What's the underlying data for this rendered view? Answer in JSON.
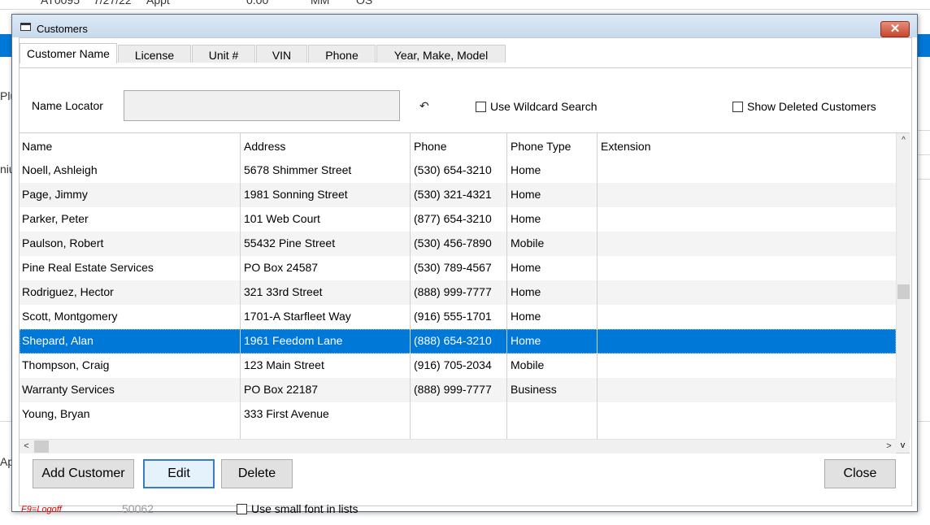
{
  "background": {
    "top_row": [
      "AT0095",
      "7/27/22",
      "Appt",
      "0.00",
      "MM",
      "OS"
    ],
    "left_fragments": [
      "Plu",
      "niu",
      "Ap"
    ]
  },
  "dialog": {
    "title": "Customers",
    "close_glyph": "✕",
    "tabs": [
      "Customer Name",
      "License",
      "Unit #",
      "VIN",
      "Phone",
      "Year, Make, Model"
    ],
    "active_tab": 0,
    "locator": {
      "label": "Name Locator",
      "value": "",
      "undo_glyph": "↶"
    },
    "options": {
      "wildcard": "Use Wildcard Search",
      "show_deleted": "Show Deleted Customers",
      "small_font": "Use small font in lists"
    },
    "grid": {
      "columns": [
        "Name",
        "Address",
        "Phone",
        "Phone Type",
        "Extension"
      ],
      "rows": [
        {
          "name": "Noell, Ashleigh",
          "address": "5678 Shimmer Street",
          "phone": "(530) 654-3210",
          "type": "Home",
          "ext": ""
        },
        {
          "name": "Page, Jimmy",
          "address": "1981 Sonning Street",
          "phone": "(530) 321-4321",
          "type": "Home",
          "ext": ""
        },
        {
          "name": "Parker, Peter",
          "address": "101 Web Court",
          "phone": "(877) 654-3210",
          "type": "Home",
          "ext": ""
        },
        {
          "name": "Paulson, Robert",
          "address": "55432 Pine Street",
          "phone": "(530) 456-7890",
          "type": "Mobile",
          "ext": ""
        },
        {
          "name": "Pine Real Estate Services",
          "address": "PO Box 24587",
          "phone": "(530) 789-4567",
          "type": "Home",
          "ext": ""
        },
        {
          "name": "Rodriguez, Hector",
          "address": "321 33rd Street",
          "phone": "(888) 999-7777",
          "type": "Home",
          "ext": ""
        },
        {
          "name": "Scott, Montgomery",
          "address": "1701-A Starfleet Way",
          "phone": "(916) 555-1701",
          "type": "Home",
          "ext": ""
        },
        {
          "name": "Shepard, Alan",
          "address": "1961 Feedom Lane",
          "phone": "(888) 654-3210",
          "type": "Home",
          "ext": ""
        },
        {
          "name": "Thompson, Craig",
          "address": "123 Main Street",
          "phone": "(916) 705-2034",
          "type": "Mobile",
          "ext": ""
        },
        {
          "name": "Warranty Services",
          "address": "PO Box 22187",
          "phone": "(888) 999-7777",
          "type": "Business",
          "ext": ""
        },
        {
          "name": "Young, Bryan",
          "address": "333 First Avenue",
          "phone": "",
          "type": "",
          "ext": ""
        }
      ],
      "selected_row": 7
    },
    "buttons": {
      "add": "Add Customer",
      "edit": "Edit",
      "delete": "Delete",
      "close": "Close"
    },
    "footer": {
      "shortcut": "F9=Logoff",
      "number": "50062"
    },
    "colors": {
      "selection": "#0078d7",
      "shortcut": "#e00000"
    }
  }
}
